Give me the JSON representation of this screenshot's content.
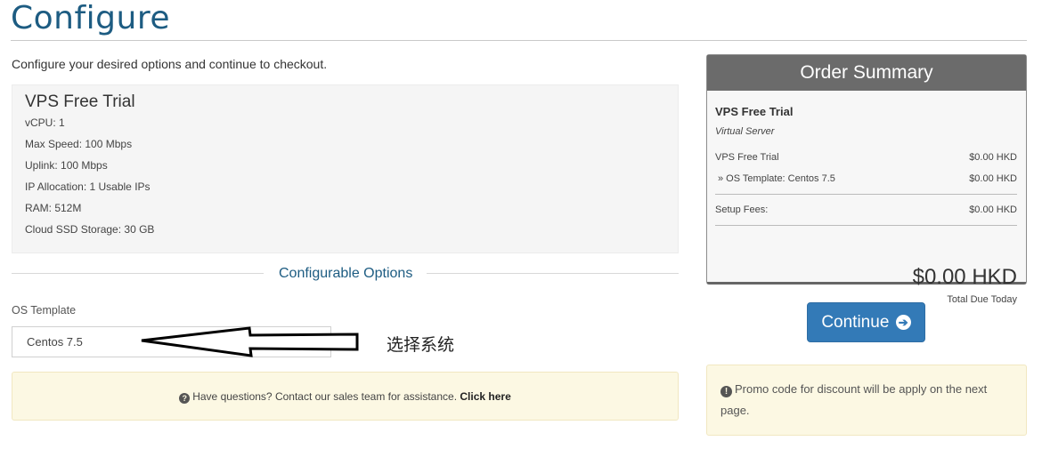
{
  "page": {
    "title": "Configure",
    "intro": "Configure your desired options and continue to checkout."
  },
  "product": {
    "name": "VPS Free Trial",
    "specs": [
      "vCPU: 1",
      "Max Speed: 100 Mbps",
      "Uplink: 100 Mbps",
      "IP Allocation: 1 Usable IPs",
      "RAM: 512M",
      "Cloud SSD Storage: 30 GB"
    ]
  },
  "options": {
    "heading": "Configurable Options",
    "os_label": "OS Template",
    "os_value": "Centos 7.5",
    "annotation": "选择系统"
  },
  "help": {
    "text": "Have questions? Contact our sales team for assistance.",
    "link": "Click here",
    "icon": "question-circle-icon"
  },
  "summary": {
    "title": "Order Summary",
    "product": "VPS Free Trial",
    "group": "Virtual Server",
    "lines": [
      {
        "label": "VPS Free Trial",
        "amount": "$0.00 HKD"
      },
      {
        "label": "» OS Template: Centos 7.5",
        "amount": "$0.00 HKD"
      }
    ],
    "setup_label": "Setup Fees:",
    "setup_amount": "$0.00 HKD",
    "total": "$0.00 HKD",
    "total_label": "Total Due Today"
  },
  "continue_label": "Continue",
  "promo": "Promo code for discount will be apply on the next page.",
  "colors": {
    "accent": "#1d5c82",
    "button": "#337ab7",
    "warning_bg": "#fcf8e3",
    "summary_header": "#6b6b6b"
  }
}
